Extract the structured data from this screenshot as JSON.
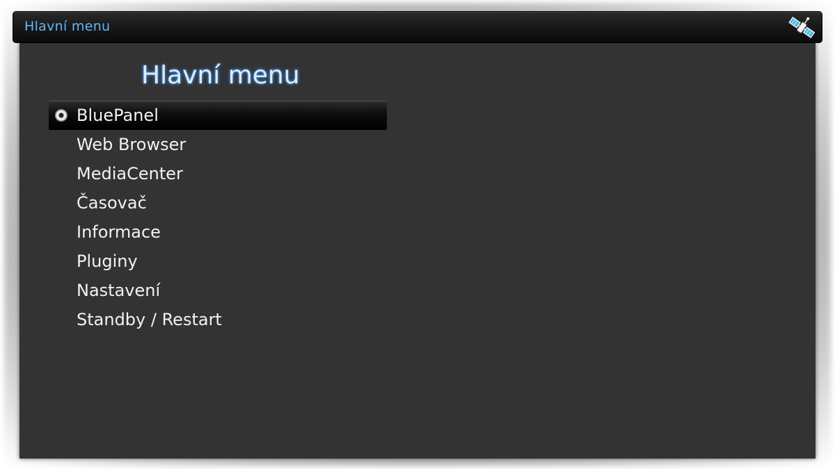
{
  "window": {
    "title": "Hlavní menu",
    "icon": "satellite-icon"
  },
  "panel": {
    "title": "Hlavní menu"
  },
  "menu": {
    "items": [
      {
        "label": "BluePanel",
        "selected": true
      },
      {
        "label": "Web Browser",
        "selected": false
      },
      {
        "label": "MediaCenter",
        "selected": false
      },
      {
        "label": "Časovač",
        "selected": false
      },
      {
        "label": "Informace",
        "selected": false
      },
      {
        "label": "Pluginy",
        "selected": false
      },
      {
        "label": "Nastavení",
        "selected": false
      },
      {
        "label": "Standby / Restart",
        "selected": false
      }
    ]
  },
  "colors": {
    "title_accent": "#5fb8ff",
    "panel_bg": "#333333",
    "text": "#f2f2f2"
  }
}
